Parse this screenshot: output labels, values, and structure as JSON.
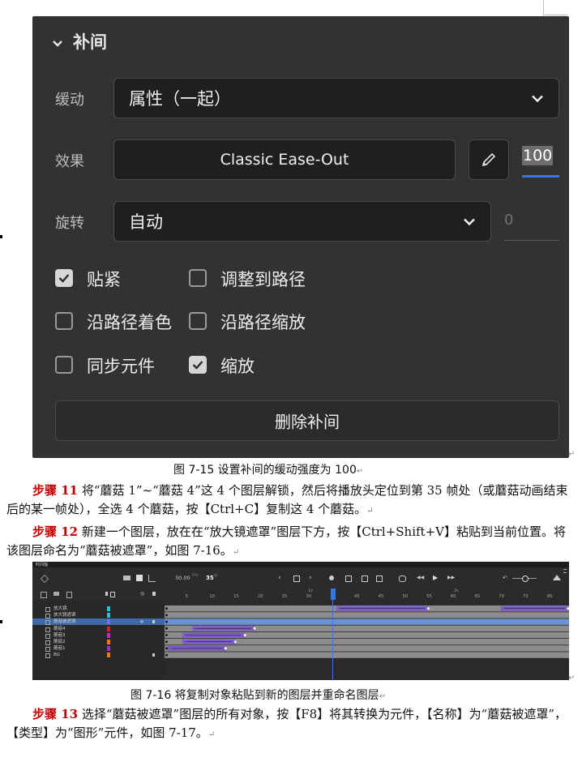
{
  "panel": {
    "section_title": "补间",
    "ease_label": "缓动",
    "ease_value": "属性（一起）",
    "effect_label": "效果",
    "effect_value": "Classic Ease-Out",
    "effect_amount": "100",
    "rotate_label": "旋转",
    "rotate_value": "自动",
    "rotate_count": "0",
    "checkboxes": [
      {
        "label": "贴紧",
        "checked": true
      },
      {
        "label": "调整到路径",
        "checked": false
      },
      {
        "label": "沿路径着色",
        "checked": false
      },
      {
        "label": "沿路径缩放",
        "checked": false
      },
      {
        "label": "同步元件",
        "checked": false
      },
      {
        "label": "缩放",
        "checked": true
      }
    ],
    "delete_button": "删除补间"
  },
  "caption1": "图  7-15  设置补间的缓动强度为 100",
  "para11": {
    "step": "步骤 11",
    "text": " 将“蘑菇 1”~“蘑菇 4”这 4 个图层解锁，然后将播放头定位到第 35 帧处（或蘑菇动画结束后的某一帧处），全选 4 个蘑菇，按【Ctrl+C】复制这 4 个蘑菇。"
  },
  "para12": {
    "step": "步骤 12",
    "text": " 新建一个图层，放在在“放大镜遮罩”图层下方，按【Ctrl+Shift+V】粘贴到当前位置。将该图层命名为“蘑菇被遮罩”，如图 7-16。"
  },
  "timeline": {
    "title": "时间轴",
    "fps": "30.00",
    "fps_unit": "FPS",
    "frame": "35",
    "frame_unit": "帧",
    "ticks": [
      "5",
      "10",
      "15",
      "20",
      "25",
      "30",
      "35",
      "40",
      "45",
      "50",
      "55",
      "60",
      "65",
      "70",
      "75",
      "80"
    ],
    "sec_marks": [
      "1s",
      "2s"
    ],
    "layers": [
      {
        "name": "放大镜",
        "color": "#19c9d8"
      },
      {
        "name": "放大镜遮罩",
        "color": "#19c9d8"
      },
      {
        "name": "蘑菇被遮罩",
        "color": "#7c6bf0"
      },
      {
        "name": "蘑菇4",
        "color": "#e01e1e"
      },
      {
        "name": "蘑菇3",
        "color": "#d21ed2"
      },
      {
        "name": "蘑菇2",
        "color": "#ff7a00"
      },
      {
        "name": "蘑菇1",
        "color": "#9a2ee0"
      },
      {
        "name": "BG",
        "color": "#ff7a00"
      }
    ]
  },
  "caption2": "图  7-16  将复制对象粘贴到新的图层并重命名图层",
  "para13": {
    "step": "步骤 13",
    "text": " 选择“蘑菇被遮罩”图层的所有对象，按【F8】将其转换为元件，【名称】为“蘑菇被遮罩”，【类型】为“图形”元件，如图 7-17。"
  }
}
